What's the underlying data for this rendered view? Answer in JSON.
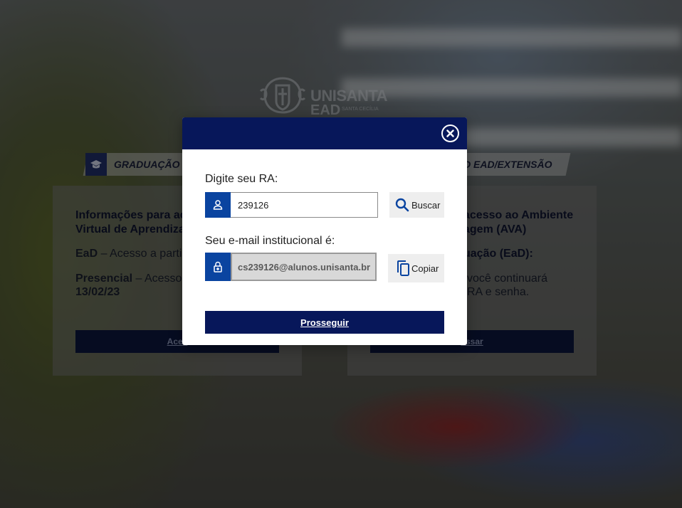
{
  "background": {
    "logo": {
      "line1": "UNISANTA",
      "line2": "EAD",
      "tagline": "SANTA CECÍLIA"
    },
    "tabs": [
      {
        "label": "GRADUAÇÃO P"
      },
      {
        "label": "ÇÃO EAD/EXTENSÃO"
      }
    ],
    "left_card": {
      "title": "Informações para ace… Virtual de Aprendizag…",
      "title_line1": "Informações para ace",
      "title_line2": "Virtual de Aprendizag",
      "ead_label": "EaD",
      "ead_text": " – Acesso a parti",
      "presencial_label": "Presencial",
      "presencial_text": " – Acesso",
      "presencial_date": "13/02/23",
      "button_label": "Aces"
    },
    "right_card": {
      "title_line1": "acesso ao Ambiente",
      "title_line2": "agem (AVA)",
      "subtitle": "uação (EaD):",
      "text_line1": "você continuará",
      "text_line2": "RA e senha.",
      "button_label": "essar"
    }
  },
  "modal": {
    "ra_label": "Digite seu RA:",
    "ra_value": "239126",
    "search_button": "Buscar",
    "email_label": "Seu e-mail institucional é:",
    "email_value": "cs239126@alunos.unisanta.br",
    "copy_button": "Copiar",
    "proceed_button": "Prosseguir"
  },
  "colors": {
    "header": "#07175a",
    "icon_bg": "#0a44a0",
    "primary_button": "#07175a"
  }
}
